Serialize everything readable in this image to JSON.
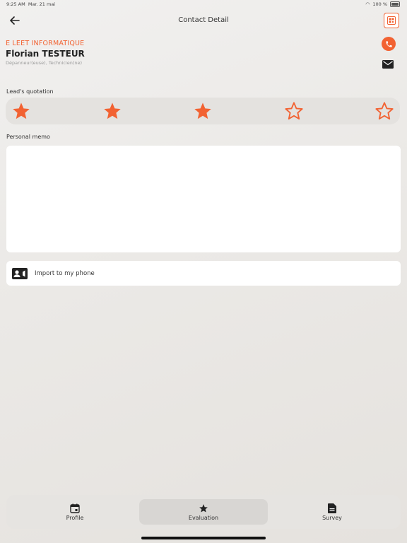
{
  "status": {
    "time": "9:25 AM",
    "date": "Mar. 21 mai",
    "battery": "100 %"
  },
  "nav": {
    "title": "Contact Detail"
  },
  "contact": {
    "company": "E LEET INFORMATIQUE",
    "name": "Florian TESTEUR",
    "role": "Dépanneur(euse), Technicien(ne)"
  },
  "quotation": {
    "label": "Lead's quotation",
    "rating": 3,
    "max": 5
  },
  "memo": {
    "label": "Personal memo",
    "value": ""
  },
  "import": {
    "label": "Import to my phone"
  },
  "tabs": [
    {
      "label": "Profile",
      "active": false
    },
    {
      "label": "Evaluation",
      "active": true
    },
    {
      "label": "Survey",
      "active": false
    }
  ],
  "colors": {
    "accent": "#f26232"
  }
}
